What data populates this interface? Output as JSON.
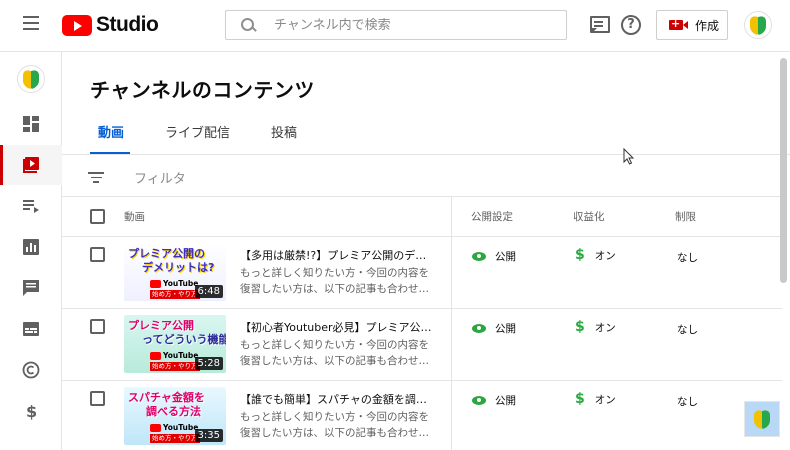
{
  "header": {
    "logo_text": "Studio",
    "search_placeholder": "チャンネル内で検索",
    "create_label": "作成",
    "icons": [
      "menu-icon",
      "youtube-logo-icon",
      "search-icon",
      "feedback-icon",
      "help-icon",
      "create-video-icon",
      "beginner-mark-avatar"
    ]
  },
  "sidebar": {
    "items": [
      {
        "name": "dashboard",
        "icon": "dashboard-icon",
        "active": false
      },
      {
        "name": "content",
        "icon": "content-icon",
        "active": true
      },
      {
        "name": "playlists",
        "icon": "playlists-icon",
        "active": false
      },
      {
        "name": "analytics",
        "icon": "analytics-icon",
        "active": false
      },
      {
        "name": "comments",
        "icon": "comments-icon",
        "active": false
      },
      {
        "name": "subtitles",
        "icon": "subtitles-icon",
        "active": false
      },
      {
        "name": "copyright",
        "icon": "copyright-icon",
        "active": false
      },
      {
        "name": "monetization",
        "icon": "dollar-icon",
        "active": false
      }
    ]
  },
  "page": {
    "title": "チャンネルのコンテンツ",
    "tabs": [
      {
        "label": "動画",
        "active": true
      },
      {
        "label": "ライブ配信",
        "active": false
      },
      {
        "label": "投稿",
        "active": false
      }
    ],
    "filter_placeholder": "フィルタ"
  },
  "table": {
    "headers": {
      "video": "動画",
      "visibility": "公開設定",
      "monetization": "収益化",
      "restrictions": "制限"
    },
    "rows": [
      {
        "title": "【多用は厳禁!?】プレミア公開のデメ…",
        "desc_line1": "もっと詳しく知りたい方・今回の内容を",
        "desc_line2": "復習したい方は、以下の記事も合わせて…",
        "thumb_text_line1": "プレミア公開の",
        "thumb_text_line2": "デメリットは?",
        "thumb_brand": "YouTube",
        "thumb_sub": "始め方・やり方",
        "duration": "6:48",
        "visibility": "公開",
        "monetization": "オン",
        "restrictions": "なし"
      },
      {
        "title": "【初心者Youtuber必見】プレミア公開…",
        "desc_line1": "もっと詳しく知りたい方・今回の内容を",
        "desc_line2": "復習したい方は、以下の記事も合わせて…",
        "thumb_text_line1": "プレミア公開",
        "thumb_text_line2": "ってどういう機能?",
        "thumb_brand": "YouTube",
        "thumb_sub": "始め方・やり方",
        "duration": "5:28",
        "visibility": "公開",
        "monetization": "オン",
        "restrictions": "なし"
      },
      {
        "title": "【誰でも簡単】スパチャの金額を調べ…",
        "desc_line1": "もっと詳しく知りたい方・今回の内容を",
        "desc_line2": "復習したい方は、以下の記事も合わせて…",
        "thumb_text_line1": "スパチャ金額を",
        "thumb_text_line2": "調べる方法",
        "thumb_brand": "YouTube",
        "thumb_sub": "始め方・やり方",
        "duration": "3:35",
        "visibility": "公開",
        "monetization": "オン",
        "restrictions": "なし"
      }
    ]
  },
  "colors": {
    "accent_blue": "#065fd4",
    "brand_red": "#ff0000",
    "status_green": "#2ba640",
    "active_red": "#cc0000"
  }
}
